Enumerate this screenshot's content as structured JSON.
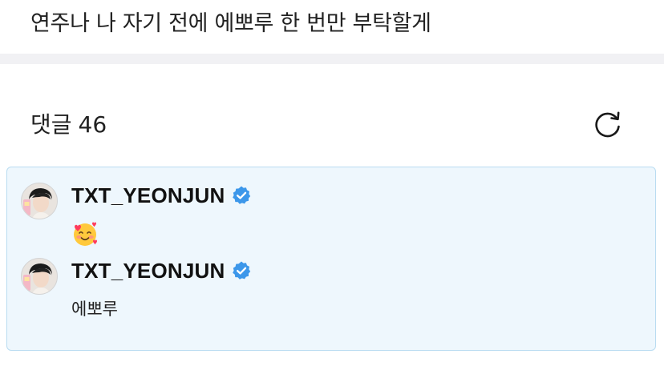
{
  "post": {
    "text": "연주나 나 자기 전에 에뽀루 한 번만 부탁할게"
  },
  "comments_section": {
    "title": "댓글",
    "count": "46",
    "refresh_icon": "refresh-icon"
  },
  "comments": [
    {
      "author": "TXT_YEONJUN",
      "verified": true,
      "content_emoji": "smiling-face-with-hearts",
      "content_text": ""
    },
    {
      "author": "TXT_YEONJUN",
      "verified": true,
      "content_emoji": "",
      "content_text": "에뽀루"
    }
  ],
  "colors": {
    "highlight_bg": "#eef7fd",
    "highlight_border": "#b9dcf1",
    "verified_blue": "#3c97ea",
    "divider": "#f1f1f4"
  }
}
